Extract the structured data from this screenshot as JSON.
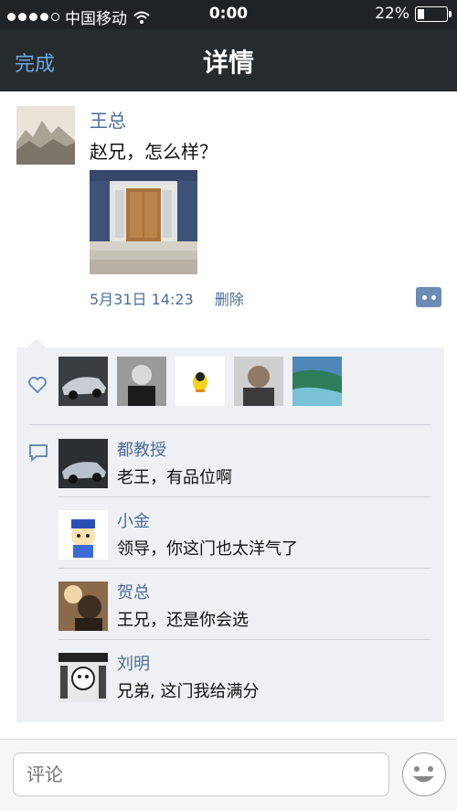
{
  "status_bar": {
    "carrier": "中国移动",
    "time": "0:00",
    "battery": "22%",
    "signal_dots": 5,
    "signal_filled": 4
  },
  "nav": {
    "done_label": "完成",
    "title": "详情"
  },
  "post": {
    "author": "王总",
    "text": "赵兄，怎么样？",
    "timestamp": "5月31日  14:23",
    "delete_label": "删除"
  },
  "likes": {
    "icon": "heart-icon",
    "count": 5
  },
  "comments": [
    {
      "name": "都教授",
      "text": "老王，有品位啊"
    },
    {
      "name": "小金",
      "text": "领导，你这门也太洋气了"
    },
    {
      "name": "贺总",
      "text": "王兄，还是你会选"
    },
    {
      "name": "刘明",
      "text": "兄弟, 这门我给满分"
    }
  ],
  "input": {
    "placeholder": "评论"
  },
  "colors": {
    "nav_bg": "#262b2e",
    "link": "#4c6b9a",
    "panel_bg": "#eef0f4"
  }
}
